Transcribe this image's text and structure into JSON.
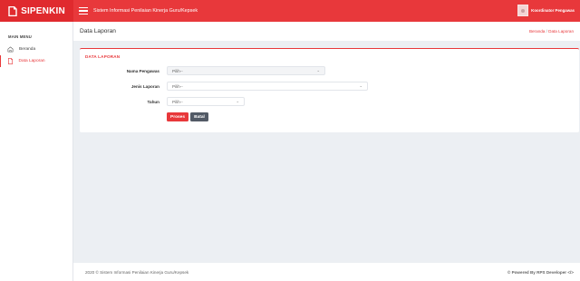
{
  "header": {
    "brand": "SIPENKIN",
    "app_title": "Sistem Informasi Penilaian Kinerja Guru/Kepsek",
    "user_name": "Koordinator Pengawas"
  },
  "sidebar": {
    "heading": "MAIN MENU",
    "items": [
      {
        "label": "Beranda",
        "icon": "home-icon"
      },
      {
        "label": "Data Laporan",
        "icon": "document-icon"
      }
    ]
  },
  "page": {
    "title": "Data Laporan",
    "breadcrumb": {
      "home": "Beranda",
      "separator": "/",
      "current": "Data Laporan"
    }
  },
  "form": {
    "card_title": "DATA LAPORAN",
    "fields": [
      {
        "label": "Nama Pengawas",
        "value": "Pilih--"
      },
      {
        "label": "Jenis Laporan",
        "value": "Pilih--"
      },
      {
        "label": "Tahun",
        "value": "Pilih--"
      }
    ],
    "submit_label": "Proses",
    "cancel_label": "Batal"
  },
  "footer": {
    "left": "2020 © Sistem Informasi Penilaian Kinerja Guru/Kepsek",
    "right": "© Powered By RPS Developer </>"
  },
  "colors": {
    "accent": "#e8383b",
    "secondary_button": "#525a66",
    "background": "#eceff3"
  }
}
